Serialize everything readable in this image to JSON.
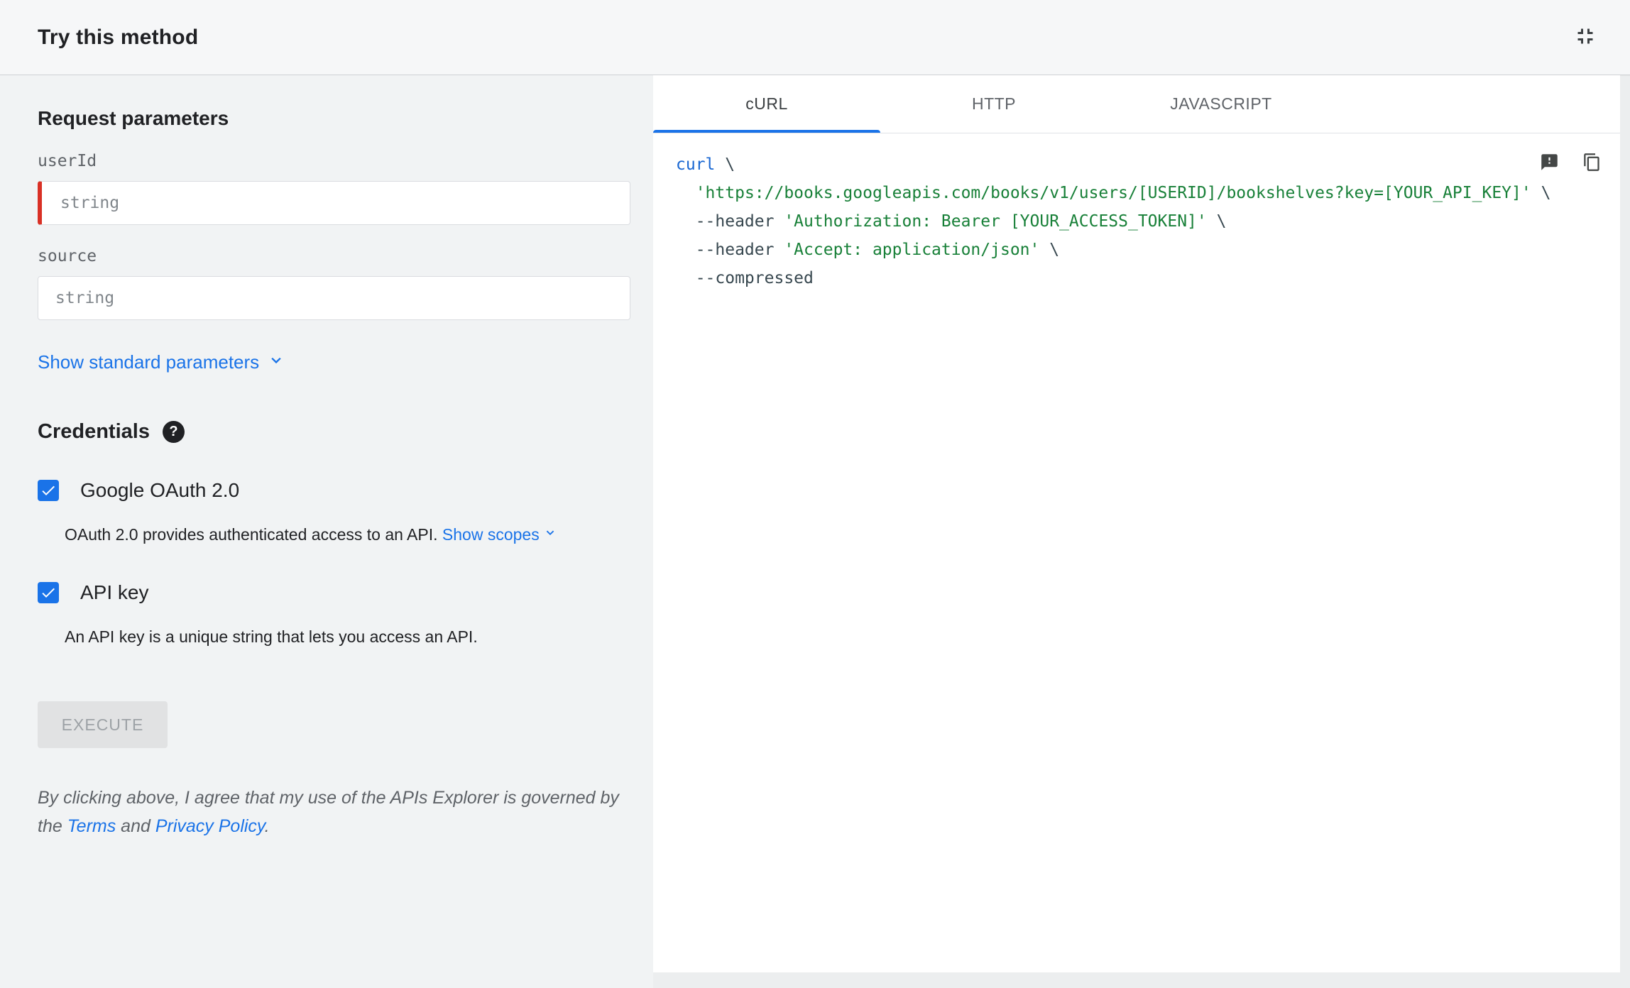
{
  "header": {
    "title": "Try this method"
  },
  "request": {
    "heading": "Request parameters",
    "fields": [
      {
        "label": "userId",
        "placeholder": "string",
        "required": true
      },
      {
        "label": "source",
        "placeholder": "string",
        "required": false
      }
    ],
    "show_standard_parameters": "Show standard parameters"
  },
  "credentials": {
    "heading": "Credentials",
    "oauth": {
      "label": "Google OAuth 2.0",
      "checked": true,
      "description": "OAuth 2.0 provides authenticated access to an API.",
      "show_scopes": "Show scopes"
    },
    "api_key": {
      "label": "API key",
      "checked": true,
      "description": "An API key is a unique string that lets you access an API."
    }
  },
  "execute": {
    "label": "EXECUTE"
  },
  "legal": {
    "prefix": "By clicking above, I agree that my use of the APIs Explorer is governed by the ",
    "terms": "Terms",
    "middle": " and ",
    "privacy": "Privacy Policy",
    "suffix": "."
  },
  "tabs": [
    {
      "label": "cURL",
      "active": true
    },
    {
      "label": "HTTP",
      "active": false
    },
    {
      "label": "JAVASCRIPT",
      "active": false
    }
  ],
  "code": {
    "colors": {
      "kwd": "#1967d2",
      "str": "#188038",
      "pln": "#37474f"
    },
    "lines": [
      [
        {
          "text": "curl",
          "type": "kwd"
        },
        {
          "text": " \\",
          "type": "pln"
        }
      ],
      [
        {
          "text": "  ",
          "type": "pln"
        },
        {
          "text": "'https://books.googleapis.com/books/v1/users/[USERID]/bookshelves?key=[YOUR_API_KEY]'",
          "type": "str"
        },
        {
          "text": " \\",
          "type": "pln"
        }
      ],
      [
        {
          "text": "  --header ",
          "type": "pln"
        },
        {
          "text": "'Authorization: Bearer [YOUR_ACCESS_TOKEN]'",
          "type": "str"
        },
        {
          "text": " \\",
          "type": "pln"
        }
      ],
      [
        {
          "text": "  --header ",
          "type": "pln"
        },
        {
          "text": "'Accept: application/json'",
          "type": "str"
        },
        {
          "text": " \\",
          "type": "pln"
        }
      ],
      [
        {
          "text": "  --compressed",
          "type": "pln"
        }
      ]
    ]
  },
  "colors": {
    "accent": "#1a73e8",
    "required": "#d93025",
    "left_panel_bg": "#f1f3f4"
  }
}
